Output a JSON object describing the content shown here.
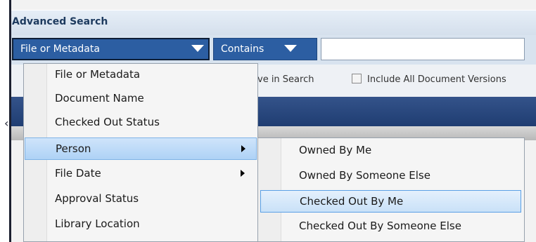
{
  "header": {
    "title": "Advanced Search"
  },
  "search": {
    "field_selected": "File or Metadata",
    "operator_selected": "Contains",
    "query_value": ""
  },
  "options": {
    "archive_label_partial": "chive in Search",
    "include_versions_label": "Include All Document Versions",
    "include_versions_checked": false
  },
  "menu": {
    "items": [
      {
        "label": "File or Metadata",
        "has_submenu": false
      },
      {
        "label": "Document Name",
        "has_submenu": false
      },
      {
        "label": "Checked Out Status",
        "has_submenu": false
      },
      {
        "label": "Person",
        "has_submenu": true,
        "highlighted": true
      },
      {
        "label": "File Date",
        "has_submenu": true
      },
      {
        "label": "Approval Status",
        "has_submenu": false
      },
      {
        "label": "Library Location",
        "has_submenu": false
      }
    ]
  },
  "submenu": {
    "items": [
      {
        "label": "Owned By Me"
      },
      {
        "label": "Owned By Someone Else"
      },
      {
        "label": "Checked Out By Me",
        "highlighted": true
      },
      {
        "label": "Checked Out By Someone Else"
      }
    ]
  },
  "colors": {
    "dropdown_bg": "#2c5ea2",
    "menu_highlight": "#aed2f6",
    "header_text": "#1d3a5e",
    "navy_bar": "#1f3d72"
  }
}
